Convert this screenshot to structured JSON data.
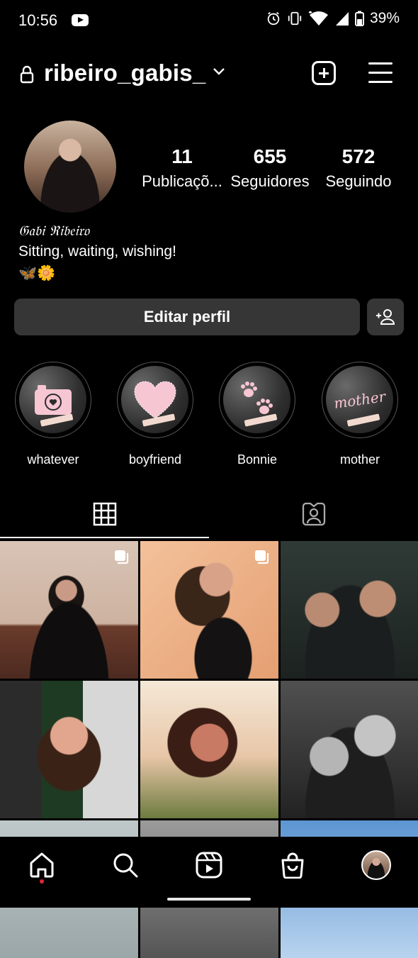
{
  "status_bar": {
    "time": "10:56",
    "battery": "39%"
  },
  "header": {
    "username": "ribeiro_gabis_"
  },
  "profile": {
    "stats": [
      {
        "value": "11",
        "label": "Publicaçõ..."
      },
      {
        "value": "655",
        "label": "Seguidores"
      },
      {
        "value": "572",
        "label": "Seguindo"
      }
    ],
    "full_name": "𝔊𝔞𝔟𝔦 ℜ𝔦𝔟𝔢𝔦𝔯𝔬",
    "bio": "Sitting, waiting, wishing!",
    "bio_emoji": "🦋🌼",
    "edit_button": "Editar perfil"
  },
  "highlights": [
    {
      "label": "whatever",
      "icon": "camera-icon"
    },
    {
      "label": "boyfriend",
      "icon": "heart-icon"
    },
    {
      "label": "Bonnie",
      "icon": "paw-icon"
    },
    {
      "label": "mother",
      "icon": "mother-text-icon"
    }
  ],
  "highlight_text": {
    "mother": "mother"
  },
  "tabs": [
    {
      "name": "grid",
      "icon": "grid-icon",
      "active": true
    },
    {
      "name": "tagged",
      "icon": "tagged-person-icon",
      "active": false
    }
  ],
  "bottom_nav": [
    "home-icon",
    "search-icon",
    "reels-icon",
    "shop-icon",
    "profile-avatar"
  ],
  "colors": {
    "background": "#000000",
    "button": "#363636",
    "notification_dot": "#e0263b"
  }
}
